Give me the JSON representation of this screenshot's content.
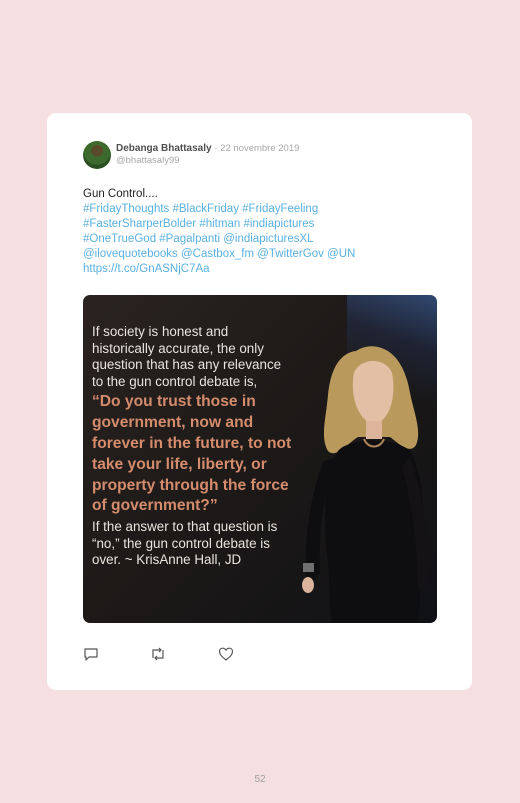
{
  "tweet": {
    "author_name": "Debanga Bhattasaly",
    "date": "· 22 novembre 2019",
    "handle": "@bhattasaly99",
    "text_intro": "Gun Control....",
    "link_lines": [
      "#FridayThoughts #BlackFriday #FridayFeeling",
      "#FasterSharperBolder #hitman #indiapictures",
      "#OneTrueGod #Pagalpanti @indiapicturesXL",
      "@ilovequotebooks @Castbox_fm @TwitterGov @UN",
      "https://t.co/GnASNjC7Aa"
    ]
  },
  "image": {
    "intro_lines": [
      "If society is honest and",
      "historically accurate, the only",
      "question that has any relevance",
      "to the gun control debate is,"
    ],
    "quote_lines": [
      "“Do you trust those in",
      "government, now and",
      "forever in the future, to not",
      "take your life, liberty, or",
      "property through the force",
      "of government?”"
    ],
    "outro_lines": [
      "If the answer to that question is",
      "“no,” the gun control debate is",
      "over. ~ KrisAnne Hall, JD"
    ],
    "quote_color": "#d58c6c"
  },
  "actions": {
    "icons": [
      "reply-icon",
      "retweet-icon",
      "like-icon"
    ]
  },
  "page": {
    "number": "52",
    "background": "#f5dfe0"
  }
}
